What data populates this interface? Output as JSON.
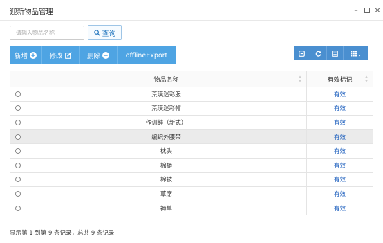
{
  "window": {
    "title": "迎新物品管理",
    "minimize_glyph": "–",
    "close_glyph": "×"
  },
  "search": {
    "placeholder": "请输入物品名称",
    "value": "",
    "query_label": "查询",
    "query_icon": "search-icon"
  },
  "toolbar": {
    "add_label": "新增",
    "edit_label": "修改",
    "delete_label": "删除",
    "export_label": "offlineExport",
    "add_icon": "plus-circle-icon",
    "edit_icon": "edit-icon",
    "delete_icon": "minus-circle-icon"
  },
  "table_tools": {
    "icons": [
      "toggle-pagination-icon",
      "refresh-icon",
      "list-view-icon",
      "columns-icon"
    ]
  },
  "table": {
    "columns": [
      "物品名称",
      "有效标记"
    ],
    "rows": [
      {
        "name": "荒漠迷彩服",
        "flag": "有效"
      },
      {
        "name": "荒漠迷彩帽",
        "flag": "有效"
      },
      {
        "name": "作训鞋（新式）",
        "flag": "有效"
      },
      {
        "name": "编织外腰带",
        "flag": "有效"
      },
      {
        "name": "枕头",
        "flag": "有效"
      },
      {
        "name": "棉褥",
        "flag": "有效"
      },
      {
        "name": "棉被",
        "flag": "有效"
      },
      {
        "name": "草席",
        "flag": "有效"
      },
      {
        "name": "褥单",
        "flag": "有效"
      }
    ],
    "highlighted_row": 3
  },
  "pagination": {
    "summary": "显示第 1 到第 9 条记录，总共 9 条记录"
  },
  "colors": {
    "toolbar_button": "#4ea4e3",
    "table_tool_button": "#4a8fd0",
    "link_blue": "#1a5dbd",
    "row_highlight": "#ebebeb"
  }
}
